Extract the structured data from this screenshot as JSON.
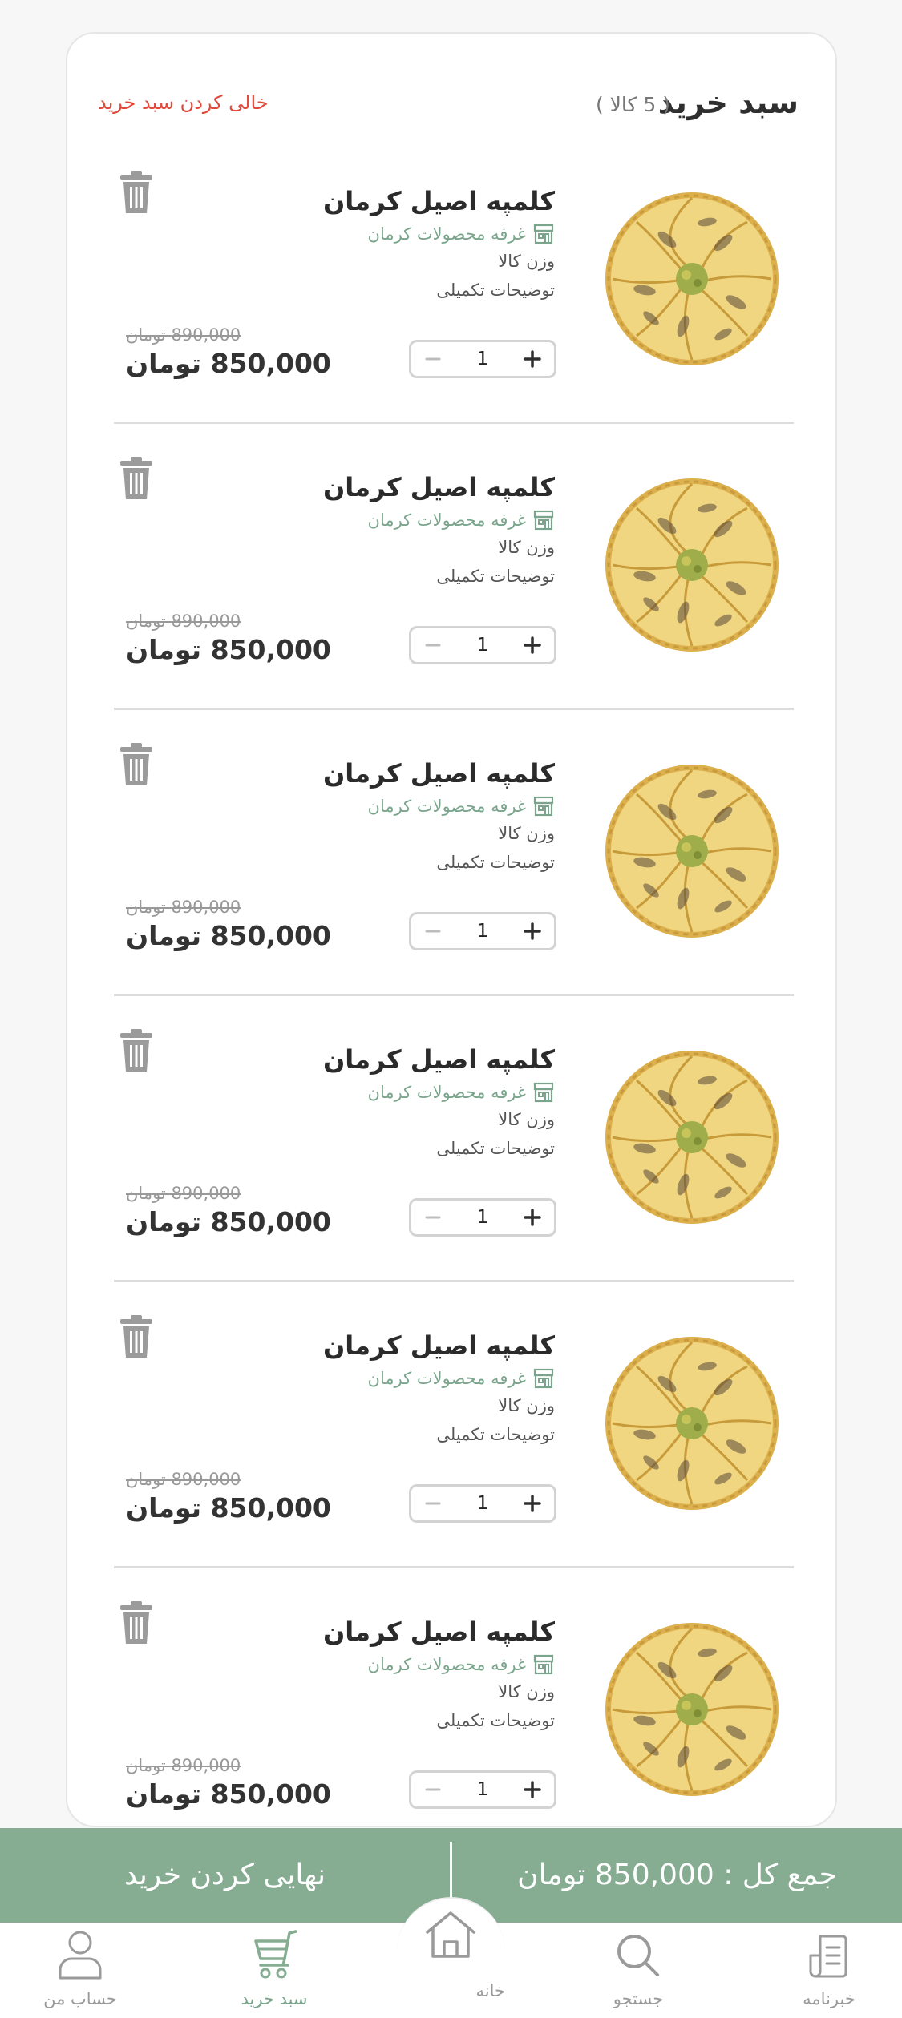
{
  "cart": {
    "title": "سبد خرید",
    "count_label": "( 5 کالا )",
    "clear_label": "خالی کردن سبد خرید"
  },
  "items": [
    {
      "name": "کلمپه اصیل کرمان",
      "shop": "غرفه محصولات کرمان",
      "weight": "وزن کالا",
      "description": "توضیحات تکمیلی",
      "quantity": "1",
      "old_price": "890,000 تومان",
      "price": "850,000 تومان"
    },
    {
      "name": "کلمپه اصیل کرمان",
      "shop": "غرفه محصولات کرمان",
      "weight": "وزن کالا",
      "description": "توضیحات تکمیلی",
      "quantity": "1",
      "old_price": "890,000 تومان",
      "price": "850,000 تومان"
    },
    {
      "name": "کلمپه اصیل کرمان",
      "shop": "غرفه محصولات کرمان",
      "weight": "وزن کالا",
      "description": "توضیحات تکمیلی",
      "quantity": "1",
      "old_price": "890,000 تومان",
      "price": "850,000 تومان"
    },
    {
      "name": "کلمپه اصیل کرمان",
      "shop": "غرفه محصولات کرمان",
      "weight": "وزن کالا",
      "description": "توضیحات تکمیلی",
      "quantity": "1",
      "old_price": "890,000 تومان",
      "price": "850,000 تومان"
    },
    {
      "name": "کلمپه اصیل کرمان",
      "shop": "غرفه محصولات کرمان",
      "weight": "وزن کالا",
      "description": "توضیحات تکمیلی",
      "quantity": "1",
      "old_price": "890,000 تومان",
      "price": "850,000 تومان"
    },
    {
      "name": "کلمپه اصیل کرمان",
      "shop": "غرفه محصولات کرمان",
      "weight": "وزن کالا",
      "description": "توضیحات تکمیلی",
      "quantity": "1",
      "old_price": "890,000 تومان",
      "price": "850,000 تومان"
    }
  ],
  "checkout": {
    "finalize_label": "نهایی کردن خرید",
    "total_label": "جمع کل : 850,000 تومان"
  },
  "nav": {
    "newsletter": "خبرنامه",
    "search": "جستجو",
    "home": "خانه",
    "cart": "سبد خرید",
    "account": "حساب من"
  },
  "colors": {
    "accent": "#86ad92",
    "accent_text": "#7aa58c",
    "danger": "#e0483a"
  },
  "icons": {
    "item_delete": "trash-icon",
    "item_shop": "store-icon",
    "item_image": "klompeh-pastry",
    "nav_newsletter": "newsletter-icon",
    "nav_search": "search-icon",
    "nav_home": "home-icon",
    "nav_cart": "cart-icon",
    "nav_account": "user-icon"
  }
}
